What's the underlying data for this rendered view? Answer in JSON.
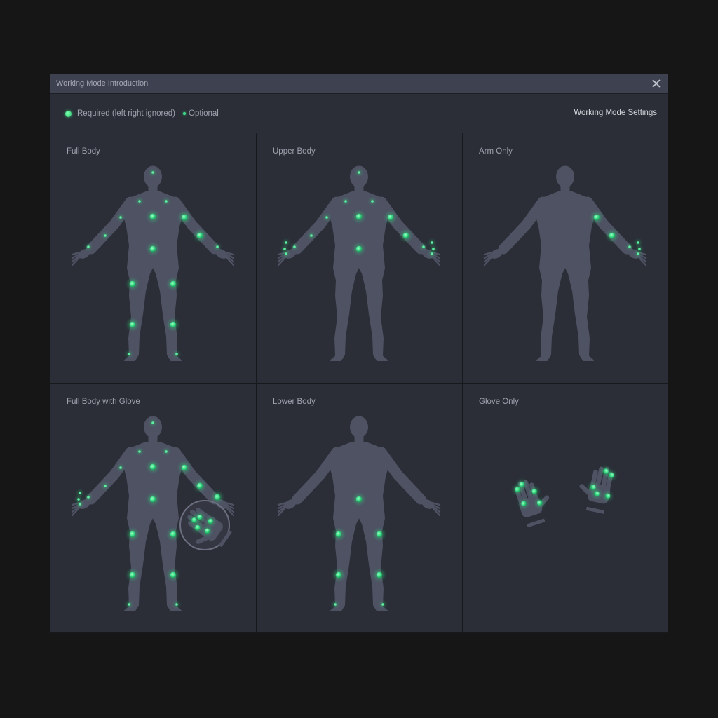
{
  "window": {
    "title": "Working Mode Introduction"
  },
  "legend": {
    "required_label": "Required (left right ignored)",
    "optional_label": "Optional"
  },
  "settings_link": "Working Mode Settings",
  "modes": [
    {
      "label": "Full Body"
    },
    {
      "label": "Upper Body"
    },
    {
      "label": "Arm Only"
    },
    {
      "label": "Full Body with Glove"
    },
    {
      "label": "Lower Body"
    },
    {
      "label": "Glove Only"
    }
  ],
  "colors": {
    "body": "#4e5263",
    "panel": "#2b2e37",
    "sensor_green": "#3ee08a"
  },
  "icons": [
    "close-icon",
    "required-dot-icon",
    "optional-dot-icon",
    "body-silhouette-icon",
    "glove-icon"
  ]
}
